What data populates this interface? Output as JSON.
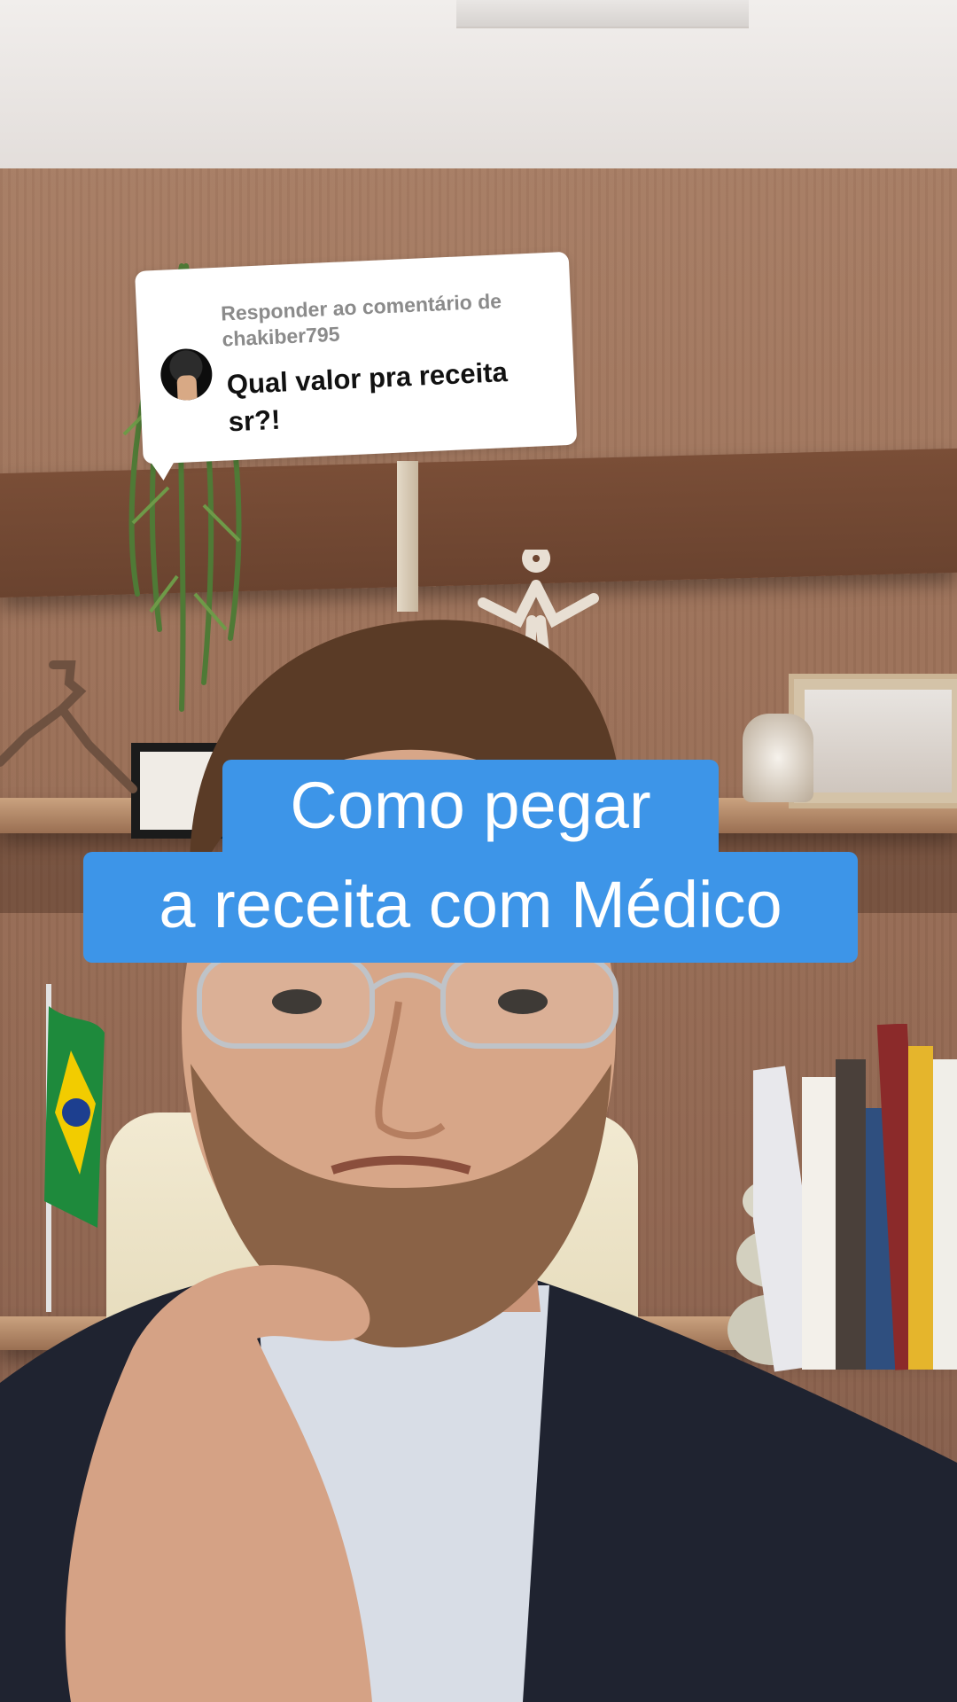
{
  "reply": {
    "header": "Responder ao comentário de chakiber795",
    "comment": "Qual valor pra receita sr?!",
    "avatar_icon": "user-avatar-icon"
  },
  "caption": {
    "line1": "Como pegar",
    "line2": "a receita com Médico",
    "background_color": "#3d95e8",
    "text_color": "#ffffff"
  }
}
